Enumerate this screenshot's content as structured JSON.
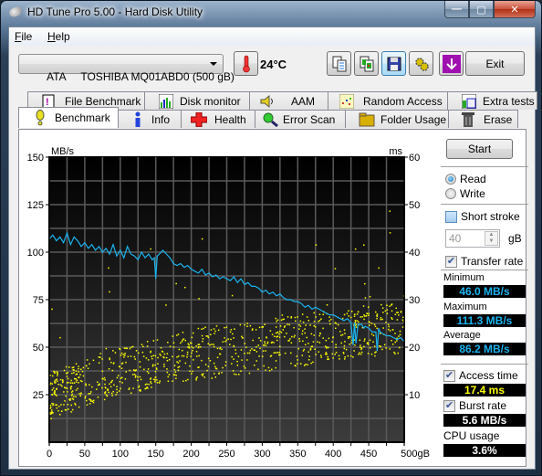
{
  "window": {
    "title": "HD Tune Pro 5.00 - Hard Disk Utility",
    "controls": {
      "minimize": "—",
      "maximize": "▢",
      "close": "✕"
    }
  },
  "menu": [
    {
      "label": "File",
      "accel": "F",
      "rest": "ile"
    },
    {
      "label": "Help",
      "accel": "H",
      "rest": "elp"
    }
  ],
  "toolbar": {
    "drive": "ATA     TOSHIBA MQ01ABD0 (500 gB)",
    "temperature": "24°C",
    "buttons": [
      {
        "name": "copy-info-button",
        "icon": "copy-text-icon"
      },
      {
        "name": "copy-screenshot-button",
        "icon": "copy-image-icon"
      },
      {
        "name": "save-button",
        "icon": "floppy-disk-icon"
      },
      {
        "name": "options-button",
        "icon": "gears-icon"
      },
      {
        "name": "update-button",
        "icon": "down-arrow-icon"
      }
    ],
    "exit_label": "Exit"
  },
  "tabs_top": [
    {
      "label": "File Benchmark",
      "icon": "file-benchmark-icon"
    },
    {
      "label": "Disk monitor",
      "icon": "disk-monitor-icon"
    },
    {
      "label": "AAM",
      "icon": "speaker-icon"
    },
    {
      "label": "Random Access",
      "icon": "random-access-icon"
    },
    {
      "label": "Extra tests",
      "icon": "extra-tests-icon"
    }
  ],
  "tabs_bottom": [
    {
      "label": "Benchmark",
      "icon": "exclamation-icon",
      "selected": true
    },
    {
      "label": "Info",
      "icon": "info-icon"
    },
    {
      "label": "Health",
      "icon": "red-cross-icon"
    },
    {
      "label": "Error Scan",
      "icon": "magnifier-icon"
    },
    {
      "label": "Folder Usage",
      "icon": "folder-icon"
    },
    {
      "label": "Erase",
      "icon": "trash-icon"
    }
  ],
  "side": {
    "start_label": "Start",
    "read_label": "Read",
    "write_label": "Write",
    "mode_selected": "Read",
    "short_stroke_label": "Short stroke",
    "short_stroke_checked": false,
    "short_stroke_value": "40",
    "short_stroke_unit": "gB",
    "transfer_rate_label": "Transfer rate",
    "transfer_rate_checked": true,
    "minimum_label": "Minimum",
    "minimum_value": "46.0 MB/s",
    "maximum_label": "Maximum",
    "maximum_value": "111.3 MB/s",
    "average_label": "Average",
    "average_value": "86.2 MB/s",
    "access_time_label": "Access time",
    "access_time_checked": true,
    "access_time_value": "17.4 ms",
    "burst_rate_label": "Burst rate",
    "burst_rate_checked": true,
    "burst_rate_value": "5.6 MB/s",
    "cpu_label": "CPU usage",
    "cpu_value": "3.6%",
    "colors": {
      "transfer": "#1ab4f0",
      "access": "#ffff00",
      "neutral": "#ffffff"
    }
  },
  "chart_data": {
    "type": "line",
    "title": "",
    "xlabel": "gB",
    "ylabel_left": "MB/s",
    "ylabel_right": "ms",
    "xlim": [
      0,
      500
    ],
    "ylim_left": [
      0,
      150
    ],
    "ylim_right": [
      0,
      60
    ],
    "x_ticks": [
      "0",
      "50",
      "100",
      "150",
      "200",
      "250",
      "300",
      "350",
      "400",
      "450",
      "500gB"
    ],
    "y_ticks_left": [
      "25",
      "50",
      "75",
      "100",
      "125",
      "150"
    ],
    "y_ticks_right": [
      "10",
      "20",
      "30",
      "40",
      "50",
      "60"
    ],
    "grid": true,
    "series": [
      {
        "name": "Transfer rate",
        "axis": "left",
        "color": "#1ab4f0",
        "x": [
          0,
          5,
          10,
          15,
          20,
          25,
          30,
          35,
          40,
          45,
          50,
          55,
          60,
          65,
          70,
          75,
          80,
          85,
          90,
          95,
          100,
          105,
          110,
          115,
          120,
          125,
          130,
          135,
          140,
          145,
          148,
          150,
          152,
          155,
          160,
          165,
          170,
          175,
          180,
          185,
          190,
          195,
          200,
          205,
          210,
          215,
          220,
          225,
          230,
          235,
          240,
          245,
          250,
          255,
          260,
          265,
          270,
          275,
          280,
          285,
          290,
          295,
          300,
          305,
          310,
          315,
          320,
          325,
          330,
          335,
          340,
          345,
          350,
          355,
          360,
          365,
          370,
          375,
          380,
          385,
          390,
          395,
          400,
          405,
          410,
          415,
          420,
          425,
          428,
          430,
          432,
          435,
          440,
          443,
          445,
          450,
          455,
          460,
          462,
          464,
          466,
          470,
          475,
          480,
          485,
          490,
          495,
          500
        ],
        "values": [
          107,
          109,
          106,
          108,
          105,
          110,
          104,
          108,
          106,
          103,
          105,
          102,
          104,
          101,
          103,
          100,
          102,
          99,
          104,
          98,
          101,
          97,
          103,
          99,
          98,
          96,
          100,
          97,
          99,
          96,
          97,
          86,
          98,
          99,
          101,
          99,
          97,
          94,
          93,
          94,
          92,
          93,
          91,
          90,
          89,
          91,
          88,
          89,
          87,
          88,
          86,
          87,
          86,
          85,
          87,
          84,
          86,
          83,
          84,
          82,
          82,
          81,
          79,
          80,
          78,
          79,
          77,
          78,
          76,
          75,
          75,
          74,
          74,
          73,
          71,
          72,
          70,
          71,
          70,
          69,
          68,
          67,
          67,
          66,
          65,
          64,
          65,
          63,
          51,
          63,
          52,
          62,
          62,
          60,
          61,
          60,
          58,
          58,
          48,
          60,
          58,
          57,
          56,
          56,
          55,
          54,
          55,
          53
        ]
      },
      {
        "name": "Access time",
        "axis": "right",
        "color": "#ffff00",
        "type": "scatter",
        "trend_ms": {
          "x": [
            0,
            100,
            200,
            300,
            400,
            500
          ],
          "low": [
            5,
            10,
            13,
            15,
            17,
            19
          ],
          "high": [
            15,
            20,
            24,
            26,
            28,
            30
          ],
          "mean_ms": 17.4
        }
      }
    ]
  }
}
